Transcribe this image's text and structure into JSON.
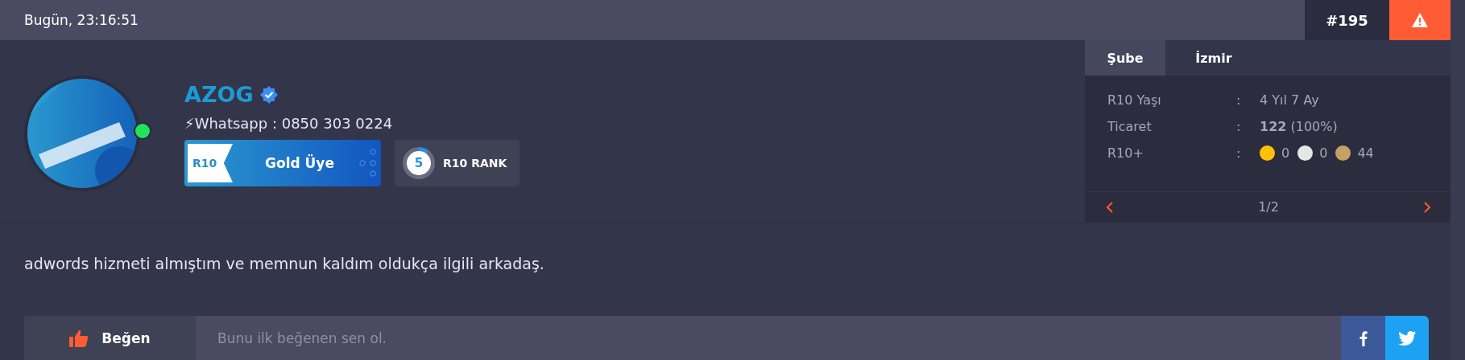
{
  "header": {
    "timestamp": "Bugün, 23:16:51",
    "post_number": "#195"
  },
  "user": {
    "name": "AZOG",
    "verified": true,
    "online": true,
    "bio_icon": "⚡",
    "bio": "Whatsapp : 0850 303 0224",
    "membership": {
      "tag": "R10",
      "label": "Gold Üye"
    },
    "rank": {
      "number": "5",
      "label": "R10 RANK"
    }
  },
  "info_panel": {
    "tabs": [
      {
        "label": "Şube",
        "selected": true
      },
      {
        "label": "İzmir",
        "selected": false
      }
    ],
    "rows": [
      {
        "kind": "text",
        "label": "R10 Yaşı",
        "separator": ":",
        "value": "4 Yıl 7 Ay"
      },
      {
        "kind": "text",
        "label": "Ticaret",
        "separator": ":",
        "value": "**122** (100%)"
      },
      {
        "kind": "medals",
        "label": "R10+",
        "separator": ":",
        "medals": [
          {
            "color": "#ffc107",
            "count": "0"
          },
          {
            "color": "#e6e6e6",
            "count": "0"
          },
          {
            "color": "#c4a165",
            "count": "44"
          }
        ]
      }
    ],
    "pager": "1/2"
  },
  "message": "adwords hizmeti almıştım ve memnun kaldım oldukça ilgili arkadaş.",
  "like_bar": {
    "button": "Beğen",
    "placeholder": "Bunu ilk beğenen sen ol."
  }
}
